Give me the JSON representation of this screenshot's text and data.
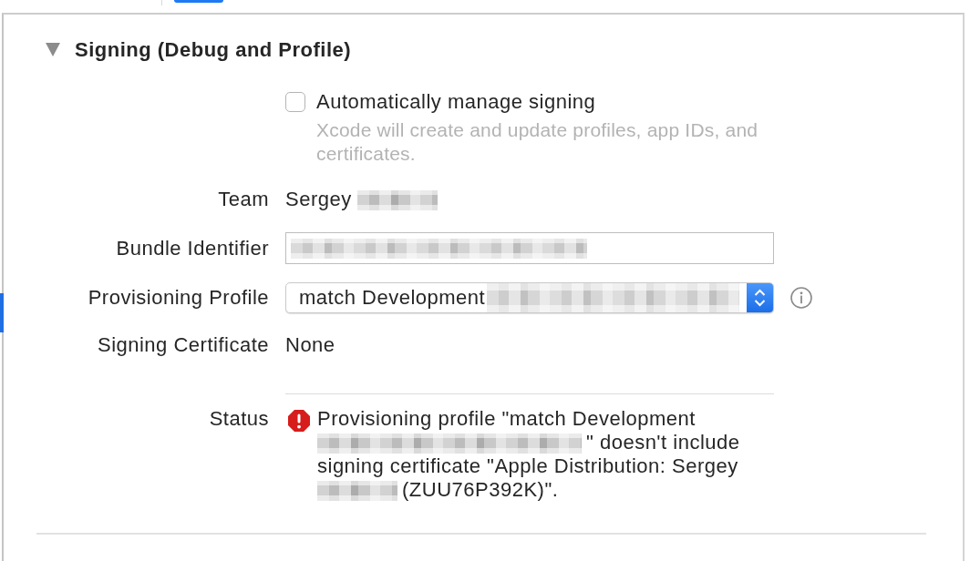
{
  "top_tabs": [
    {
      "selected": true
    }
  ],
  "section": {
    "title": "Signing (Debug and Profile)",
    "expanded": true
  },
  "auto_signing": {
    "label": "Automatically manage signing",
    "checked": false,
    "description": "Xcode will create and update profiles, app IDs, and certificates."
  },
  "fields": [
    {
      "kind": "text",
      "label": "Team",
      "value": [
        {
          "kind": "text",
          "text": "Sergey"
        },
        {
          "kind": "redacted_short"
        }
      ]
    },
    {
      "kind": "input",
      "label": "Bundle Identifier",
      "value": [
        {
          "kind": "redacted_long"
        }
      ]
    },
    {
      "kind": "popup",
      "label": "Provisioning Profile",
      "value": [
        {
          "kind": "text",
          "text": "match Development"
        },
        {
          "kind": "redacted_long"
        }
      ]
    },
    {
      "kind": "text",
      "label": "Signing Certificate",
      "value": [
        {
          "kind": "text",
          "text": "None"
        }
      ]
    }
  ],
  "status": {
    "label": "Status",
    "error": true,
    "message": [
      {
        "kind": "text",
        "text": "Provisioning profile \"match Development"
      },
      {
        "kind": "redacted_long"
      },
      {
        "kind": "text",
        "text": "\" doesn't include signing certificate \"Apple Distribution: Sergey"
      },
      {
        "kind": "redacted_short"
      },
      {
        "kind": "text",
        "text": "(ZUU76P392K)\"."
      }
    ]
  }
}
